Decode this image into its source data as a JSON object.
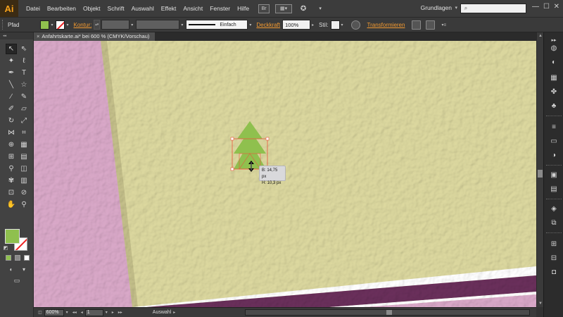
{
  "app": {
    "logo_text": "Ai"
  },
  "menu": {
    "items": [
      "Datei",
      "Bearbeiten",
      "Objekt",
      "Schrift",
      "Auswahl",
      "Effekt",
      "Ansicht",
      "Fenster",
      "Hilfe"
    ],
    "bridge_label": "Br",
    "workspace": "Grundlagen",
    "search_placeholder": ""
  },
  "controlbar": {
    "selection_type": "Pfad",
    "fill_color": "#8fc04e",
    "stroke_label": "Kontur:",
    "stroke_style": "Einfach",
    "opacity_label": "Deckkraft",
    "opacity_value": "100%",
    "style_label": "Stil:",
    "transform_label": "Transformieren"
  },
  "document": {
    "tab_title": "Anfahrtskarte.ai* bei 600 % (CMYK/Vorschau)"
  },
  "canvas": {
    "background_color": "#dcd89f",
    "pink_color": "#d9a8c8",
    "purple_color": "#6a2f5b",
    "tree_color": "#8fc04e",
    "selection_color": "#e8553c"
  },
  "tooltip": {
    "width": "B: 14,75 px",
    "height": "H: 10,3 px"
  },
  "statusbar": {
    "zoom": "600%",
    "page": "1",
    "tool_name": "Auswahl"
  }
}
